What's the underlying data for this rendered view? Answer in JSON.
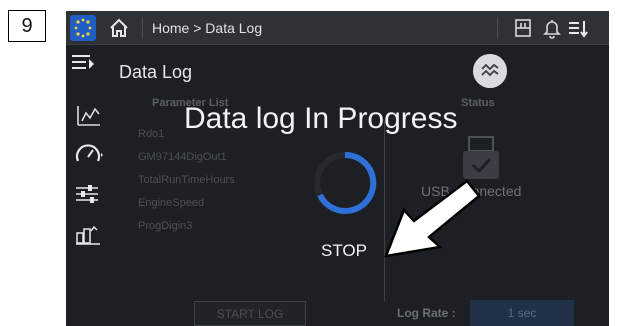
{
  "step_number": "9",
  "topbar": {
    "breadcrumb": "Home > Data Log"
  },
  "page": {
    "title": "Data Log"
  },
  "background_table": {
    "parameter_header": "Parameter List",
    "status_header": "Status",
    "parameters": [
      "Rdo1",
      "GM97144DigOut1",
      "TotalRunTimeHours",
      "EngineSpeed",
      "ProgDigin3"
    ],
    "usb_status": "USB Connected",
    "start_label": "START LOG",
    "log_rate_label": "Log Rate :",
    "log_rate_value": "1 sec"
  },
  "overlay": {
    "message": "Data log In Progress",
    "stop_label": "STOP"
  },
  "icons": {
    "logo": "brand-dots-icon",
    "home": "home-icon",
    "printer": "printer-icon",
    "bell": "bell-icon",
    "sort": "sort-icon",
    "menu": "menu-icon",
    "trend": "trend-icon",
    "spinner": "progress-spinner-icon",
    "pointer": "callout-arrow-icon"
  },
  "colors": {
    "screen_bg": "#1c1f23",
    "topbar_bg": "#2e3136",
    "spinner": "#2f6fd8",
    "logo_blue": "#1f5fc4"
  }
}
